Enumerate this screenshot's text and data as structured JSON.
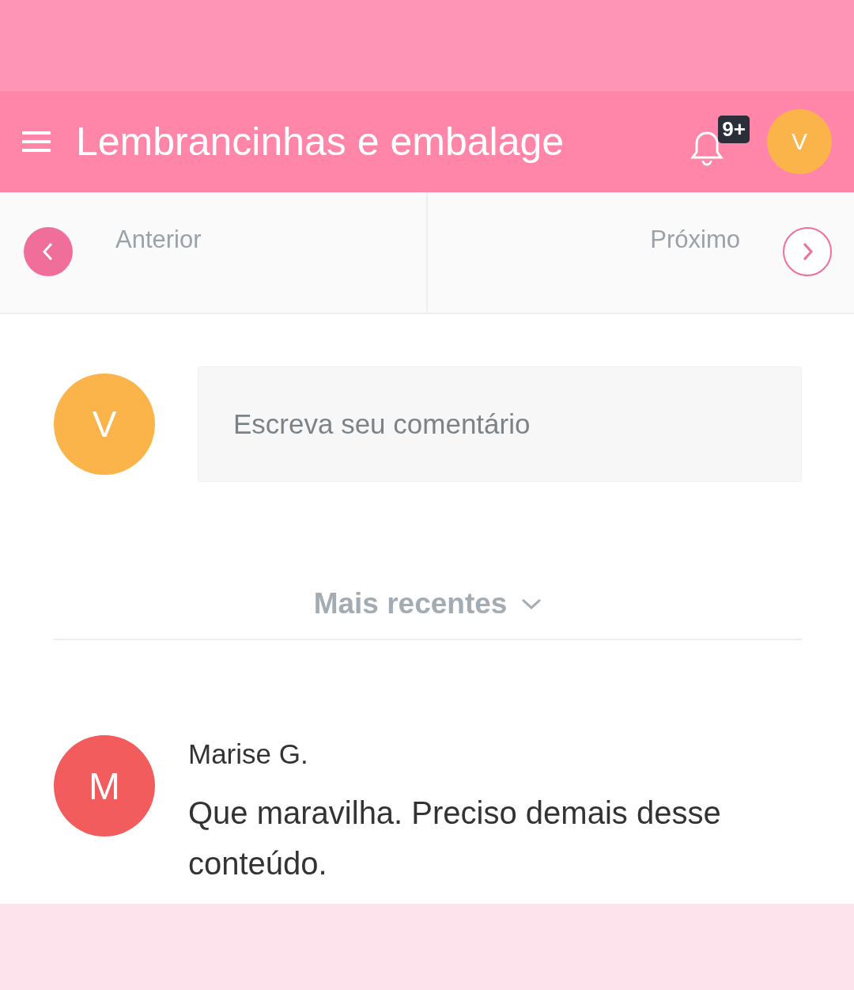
{
  "header": {
    "title": "Lembrancinhas e embalage",
    "notification_badge": "9+",
    "avatar_letter": "V"
  },
  "pager": {
    "previous": "Anterior",
    "next": "Próximo"
  },
  "comment_form": {
    "avatar_letter": "V",
    "placeholder": "Escreva seu comentário"
  },
  "sort": {
    "label": "Mais recentes"
  },
  "comments": [
    {
      "avatar_letter": "M",
      "color": "#f25c5c",
      "author": "Marise G.",
      "text": "Que maravilha. Preciso demais desse conteúdo."
    }
  ]
}
